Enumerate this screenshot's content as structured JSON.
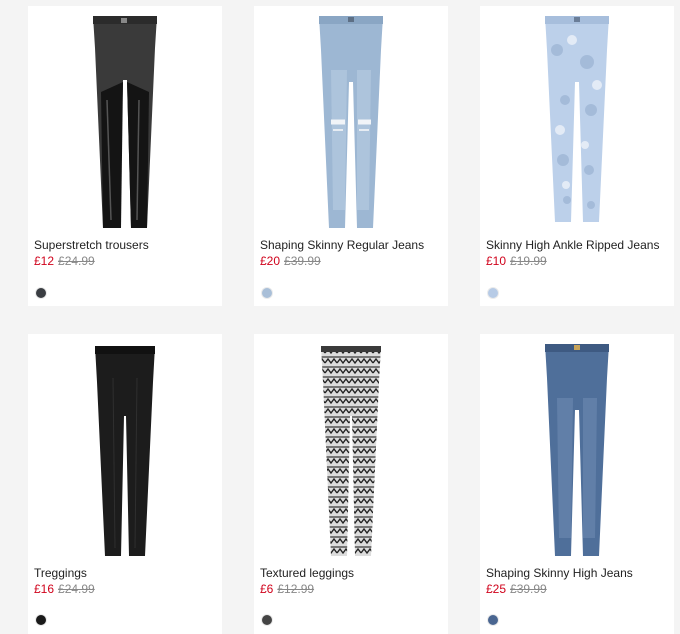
{
  "products": [
    {
      "title": "Superstretch trousers",
      "price": "£12",
      "old_price": "£24.99",
      "swatch": "#3a3d42",
      "style": "black-leather"
    },
    {
      "title": "Shaping Skinny Regular Jeans",
      "price": "£20",
      "old_price": "£39.99",
      "swatch": "#a9bfd8",
      "style": "light-denim-ripped"
    },
    {
      "title": "Skinny High Ankle Ripped Jeans",
      "price": "£10",
      "old_price": "£19.99",
      "swatch": "#b7cbe6",
      "style": "acid-wash"
    },
    {
      "title": "Treggings",
      "price": "£16",
      "old_price": "£24.99",
      "swatch": "#1a1a1a",
      "style": "black"
    },
    {
      "title": "Textured leggings",
      "price": "£6",
      "old_price": "£12.99",
      "swatch": "#444444",
      "style": "pattern"
    },
    {
      "title": "Shaping Skinny High Jeans",
      "price": "£25",
      "old_price": "£39.99",
      "swatch": "#4a6691",
      "style": "mid-denim"
    }
  ]
}
